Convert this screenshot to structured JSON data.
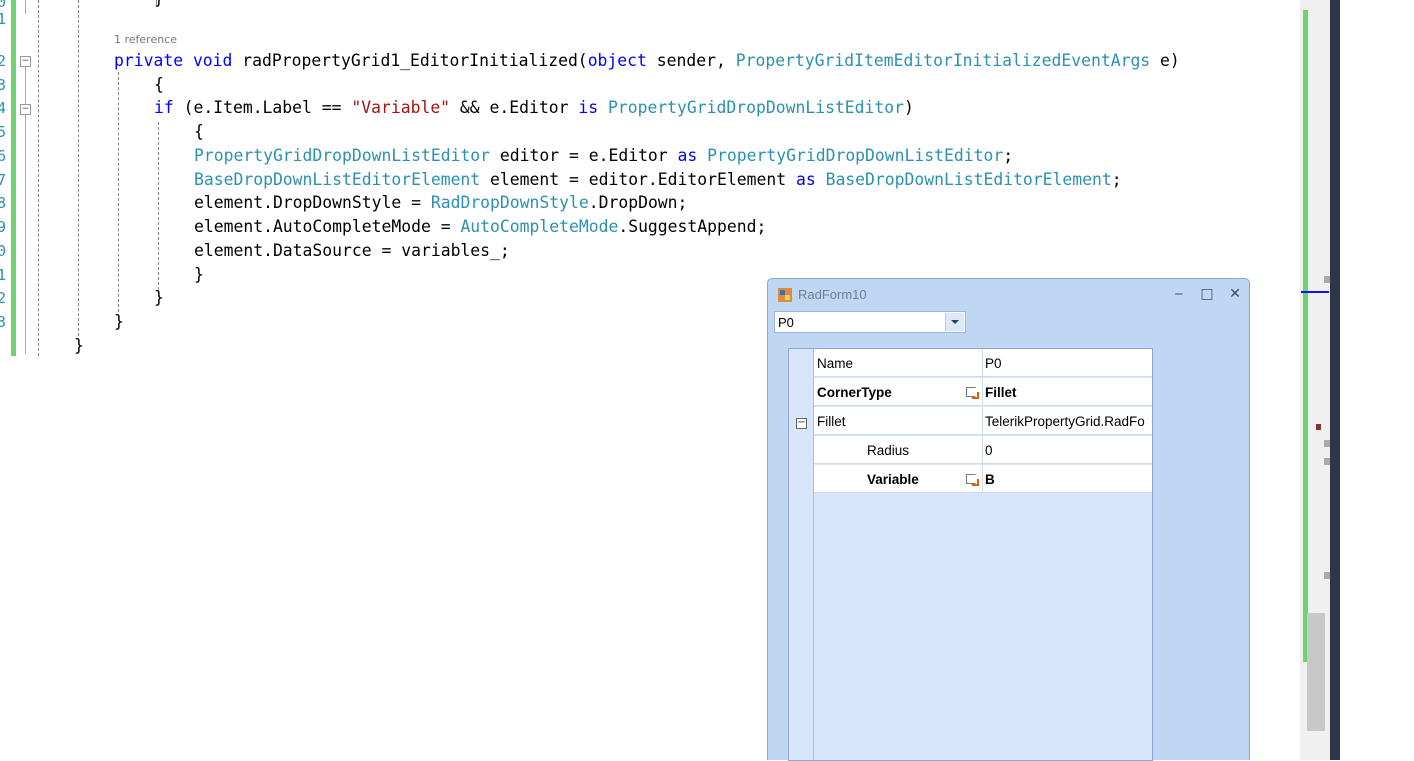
{
  "editor": {
    "line_numbers": [
      "0",
      "1",
      "2",
      "3",
      "4",
      "5",
      "6",
      "7",
      "8",
      "9",
      "0",
      "1",
      "2",
      "3"
    ],
    "codelens": "1 reference",
    "lines": {
      "l1_kw": "private void ",
      "l1_name": "radPropertyGrid1_EditorInitialized(",
      "l1_obj": "object",
      "l1_sender": " sender, ",
      "l1_type": "PropertyGridItemEditorInitializedEventArgs",
      "l1_end": " e)",
      "l2": "{",
      "l3_if": "if",
      "l3_a": " (e.Item.Label == ",
      "l3_str": "\"Variable\"",
      "l3_b": " && e.Editor ",
      "l3_is": "is",
      "l3_type": " PropertyGridDropDownListEditor",
      "l3_end": ")",
      "l4": "{",
      "l5_type": "PropertyGridDropDownListEditor",
      "l5_a": " editor = e.Editor ",
      "l5_as": "as",
      "l5_type2": " PropertyGridDropDownListEditor",
      "l5_end": ";",
      "l6_type": "BaseDropDownListEditorElement",
      "l6_a": " element = editor.EditorElement ",
      "l6_as": "as",
      "l6_type2": " BaseDropDownListEditorElement",
      "l6_end": ";",
      "l7_a": "element.DropDownStyle = ",
      "l7_type": "RadDropDownStyle",
      "l7_end": ".DropDown;",
      "l8_a": "element.AutoCompleteMode = ",
      "l8_type": "AutoCompleteMode",
      "l8_end": ".SuggestAppend;",
      "l9": "element.DataSource = variables_;",
      "l10": "}",
      "l11": "}",
      "l12": "}",
      "l13": "}",
      "top_brace": "}"
    }
  },
  "form": {
    "title": "RadForm10",
    "combo_value": "P0",
    "controls": {
      "minimize": "‒",
      "maximize": "□",
      "close": "✕"
    },
    "rows": [
      {
        "name": "Name",
        "value": "P0"
      },
      {
        "name": "CornerType",
        "value": "Fillet"
      },
      {
        "name": "Fillet",
        "value": "TelerikPropertyGrid.RadFo"
      },
      {
        "name": "Radius",
        "value": "0"
      },
      {
        "name": "Variable",
        "value": "B"
      }
    ]
  },
  "colors": {
    "keyword": "#0000ff",
    "type": "#2b91af",
    "string": "#a31515",
    "change_bar": "#6fd36f"
  }
}
